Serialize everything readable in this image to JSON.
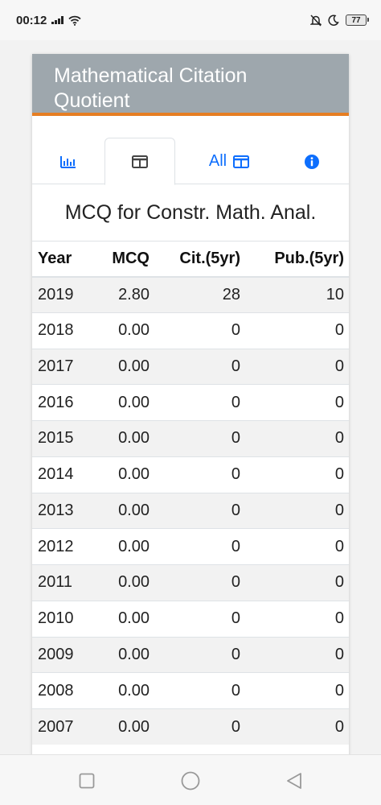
{
  "status_bar": {
    "time": "00:12",
    "battery": "77",
    "icons": [
      "signal-icon",
      "wifi-icon",
      "mute-icon",
      "moon-icon",
      "battery-icon"
    ]
  },
  "card": {
    "title": "Mathematical Citation Quotient",
    "tabs": [
      {
        "name": "chart",
        "icon": "bar-chart-icon",
        "label": ""
      },
      {
        "name": "table",
        "icon": "table-icon",
        "label": "",
        "active": true
      },
      {
        "name": "all",
        "icon": "table-icon",
        "label": "All"
      },
      {
        "name": "info",
        "icon": "info-icon",
        "label": ""
      }
    ],
    "section_title": "MCQ for Constr. Math. Anal.",
    "table": {
      "headers": [
        "Year",
        "MCQ",
        "Cit.(5yr)",
        "Pub.(5yr)"
      ],
      "rows": [
        [
          "2019",
          "2.80",
          "28",
          "10"
        ],
        [
          "2018",
          "0.00",
          "0",
          "0"
        ],
        [
          "2017",
          "0.00",
          "0",
          "0"
        ],
        [
          "2016",
          "0.00",
          "0",
          "0"
        ],
        [
          "2015",
          "0.00",
          "0",
          "0"
        ],
        [
          "2014",
          "0.00",
          "0",
          "0"
        ],
        [
          "2013",
          "0.00",
          "0",
          "0"
        ],
        [
          "2012",
          "0.00",
          "0",
          "0"
        ],
        [
          "2011",
          "0.00",
          "0",
          "0"
        ],
        [
          "2010",
          "0.00",
          "0",
          "0"
        ],
        [
          "2009",
          "0.00",
          "0",
          "0"
        ],
        [
          "2008",
          "0.00",
          "0",
          "0"
        ],
        [
          "2007",
          "0.00",
          "0",
          "0"
        ]
      ]
    }
  },
  "colors": {
    "header_bg": "#9ea7ad",
    "header_border": "#e67e22",
    "link": "#0d6efd",
    "stripe": "#f2f2f2"
  },
  "nav_bar": {
    "buttons": [
      "recents-square-icon",
      "home-circle-icon",
      "back-triangle-icon"
    ]
  }
}
